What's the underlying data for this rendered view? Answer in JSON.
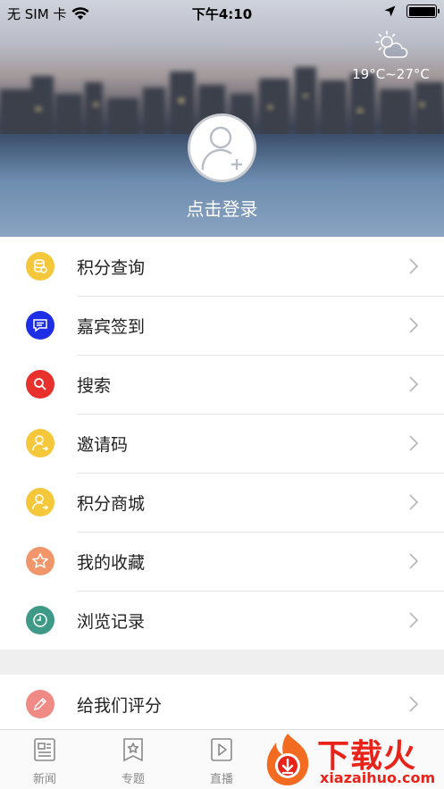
{
  "status_bar": {
    "carrier": "无 SIM 卡",
    "time": "下午4:10"
  },
  "weather": {
    "icon": "partly-cloudy-icon",
    "temperature": "19°C~27°C"
  },
  "profile": {
    "avatar_icon": "add-user-avatar-icon",
    "login_label": "点击登录"
  },
  "menu": {
    "items": [
      {
        "label": "积分查询",
        "icon": "coins-icon",
        "color": "#f5c73a"
      },
      {
        "label": "嘉宾签到",
        "icon": "message-icon",
        "color": "#1e2ee6"
      },
      {
        "label": "搜索",
        "icon": "search-icon",
        "color": "#e8302c"
      },
      {
        "label": "邀请码",
        "icon": "user-share-icon",
        "color": "#f5c73a"
      },
      {
        "label": "积分商城",
        "icon": "user-share-icon",
        "color": "#f5c73a"
      },
      {
        "label": "我的收藏",
        "icon": "star-icon",
        "color": "#f0966a"
      },
      {
        "label": "浏览记录",
        "icon": "clock-icon",
        "color": "#3e9a86"
      }
    ]
  },
  "menu2": {
    "items": [
      {
        "label": "给我们评分",
        "icon": "pencil-icon",
        "color": "#f08a84"
      }
    ]
  },
  "tabbar": {
    "tabs": [
      {
        "label": "新闻",
        "icon": "news-icon"
      },
      {
        "label": "专题",
        "icon": "topic-star-icon"
      },
      {
        "label": "直播",
        "icon": "play-icon"
      }
    ]
  },
  "watermark": {
    "title": "下载火",
    "url": "xiazaihuo.com"
  }
}
